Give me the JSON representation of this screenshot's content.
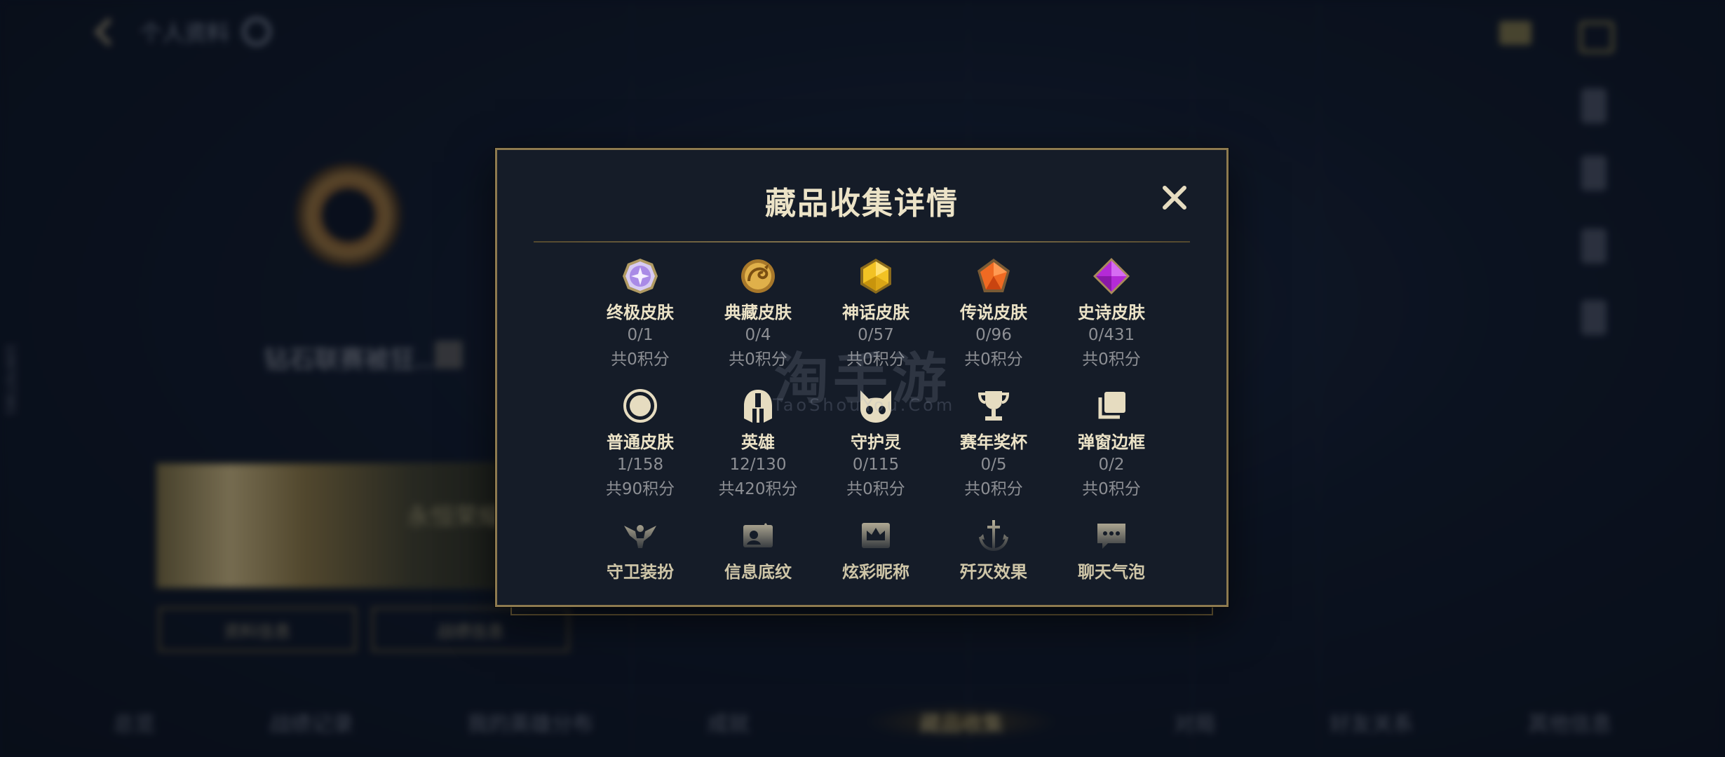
{
  "background": {
    "top_title": "个人资料",
    "vertical_id": "109707381",
    "player_name": "钻石联赛被狂...",
    "banner_text": "永恒荣耀",
    "buttons": [
      "资料信息",
      "战绩信息"
    ],
    "bottom_tabs": [
      "总览",
      "战绩记录",
      "我的英雄分布",
      "成就",
      "藏品收集",
      "对局",
      "好友关系",
      "其他信息"
    ],
    "active_tab_index": 4
  },
  "modal": {
    "title": "藏品收集详情",
    "close_label": "✕",
    "items": [
      {
        "name": "终极皮肤",
        "count": "0/1",
        "points": "共0积分",
        "icon": "ultimate-gem-icon"
      },
      {
        "name": "典藏皮肤",
        "count": "0/4",
        "points": "共0积分",
        "icon": "dragon-medallion-icon"
      },
      {
        "name": "神话皮肤",
        "count": "0/57",
        "points": "共0积分",
        "icon": "gold-gem-icon"
      },
      {
        "name": "传说皮肤",
        "count": "0/96",
        "points": "共0积分",
        "icon": "orange-gem-icon"
      },
      {
        "name": "史诗皮肤",
        "count": "0/431",
        "points": "共0积分",
        "icon": "purple-gem-icon"
      },
      {
        "name": "普通皮肤",
        "count": "1/158",
        "points": "共90积分",
        "icon": "circle-target-icon"
      },
      {
        "name": "英雄",
        "count": "12/130",
        "points": "共420积分",
        "icon": "helmet-icon"
      },
      {
        "name": "守护灵",
        "count": "0/115",
        "points": "共0积分",
        "icon": "cat-face-icon"
      },
      {
        "name": "赛年奖杯",
        "count": "0/5",
        "points": "共0积分",
        "icon": "trophy-icon"
      },
      {
        "name": "弹窗边框",
        "count": "0/2",
        "points": "共0积分",
        "icon": "stacked-frames-icon"
      },
      {
        "name": "守卫装扮",
        "icon": "ward-icon"
      },
      {
        "name": "信息底纹",
        "icon": "profile-card-icon"
      },
      {
        "name": "炫彩昵称",
        "icon": "crown-card-icon"
      },
      {
        "name": "歼灭效果",
        "icon": "sword-anchor-icon"
      },
      {
        "name": "聊天气泡",
        "icon": "chat-bubble-icon"
      }
    ]
  },
  "watermark": {
    "main": "淘手游",
    "sub": "TaoShouYou.Com"
  },
  "colors": {
    "accent_gold": "#8d7a4f",
    "title_text": "#ece3c7",
    "muted_text": "#8d8f94",
    "modal_bg": "#151c28"
  }
}
